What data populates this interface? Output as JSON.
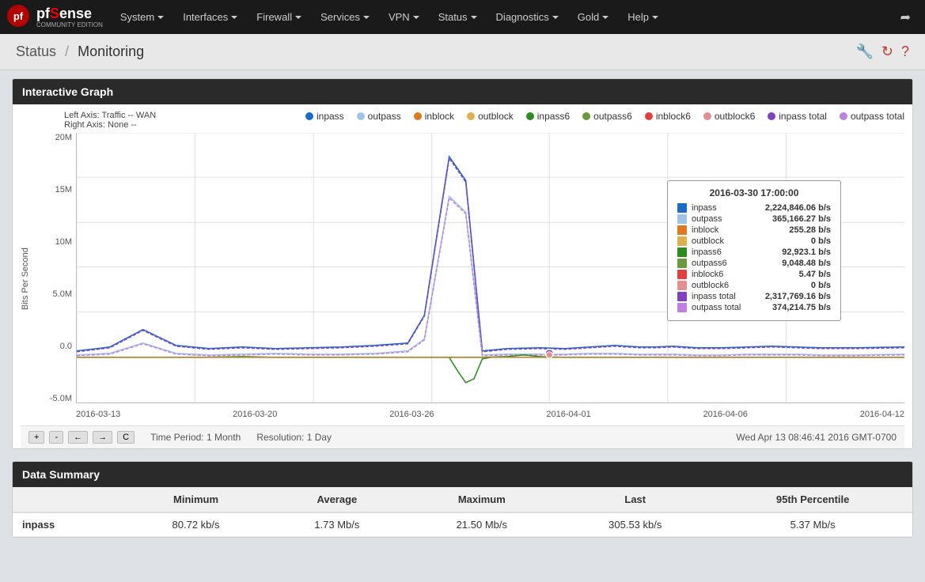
{
  "navbar": {
    "brand": "pfSense",
    "brand_highlight": "S",
    "brand_sub": "COMMUNITY EDITION",
    "items": [
      {
        "label": "System",
        "has_caret": true
      },
      {
        "label": "Interfaces",
        "has_caret": true
      },
      {
        "label": "Firewall",
        "has_caret": true
      },
      {
        "label": "Services",
        "has_caret": true
      },
      {
        "label": "VPN",
        "has_caret": true
      },
      {
        "label": "Status",
        "has_caret": true
      },
      {
        "label": "Diagnostics",
        "has_caret": true
      },
      {
        "label": "Gold",
        "has_caret": true
      },
      {
        "label": "Help",
        "has_caret": true
      }
    ]
  },
  "page": {
    "breadcrumb_parent": "Status",
    "breadcrumb_current": "Monitoring",
    "title": "Status / Monitoring"
  },
  "graph": {
    "section_title": "Interactive Graph",
    "axis_left": "Left Axis: Traffic -- WAN",
    "axis_right": "Right Axis: None --",
    "y_axis_label": "Bits Per Second",
    "y_ticks": [
      "20M",
      "15M",
      "10M",
      "5.0M",
      "0.0",
      "-5.0M"
    ],
    "x_labels": [
      "2016-03-13",
      "2016-03-20",
      "2016-03-26",
      "2016-04-01",
      "2016-04-06",
      "2016-04-12"
    ],
    "legend": [
      {
        "label": "inpass",
        "color": "#1a6cc4"
      },
      {
        "label": "outpass",
        "color": "#a0c4e8"
      },
      {
        "label": "inblock",
        "color": "#e07820"
      },
      {
        "label": "outblock",
        "color": "#e0b050"
      },
      {
        "label": "inpass6",
        "color": "#2e8b20"
      },
      {
        "label": "outpass6",
        "color": "#6a9a40"
      },
      {
        "label": "inblock6",
        "color": "#e04040"
      },
      {
        "label": "outblock6",
        "color": "#e09090"
      },
      {
        "label": "inpass total",
        "color": "#8040c0"
      },
      {
        "label": "outpass total",
        "color": "#c080e0"
      }
    ],
    "tooltip": {
      "timestamp": "2016-03-30 17:00:00",
      "rows": [
        {
          "label": "inpass",
          "value": "2,224,846.06 b/s",
          "color": "#1a6cc4"
        },
        {
          "label": "outpass",
          "value": "365,166.27 b/s",
          "color": "#a0c4e8"
        },
        {
          "label": "inblock",
          "value": "255.28 b/s",
          "color": "#e07820"
        },
        {
          "label": "outblock",
          "value": "0 b/s",
          "color": "#e0b050"
        },
        {
          "label": "inpass6",
          "value": "92,923.1 b/s",
          "color": "#2e8b20"
        },
        {
          "label": "outpass6",
          "value": "9,048.48 b/s",
          "color": "#6a9a40"
        },
        {
          "label": "inblock6",
          "value": "5.47 b/s",
          "color": "#e04040"
        },
        {
          "label": "outblock6",
          "value": "0 b/s",
          "color": "#e09090"
        },
        {
          "label": "inpass total",
          "value": "2,317,769.16 b/s",
          "color": "#8040c0"
        },
        {
          "label": "outpass total",
          "value": "374,214.75 b/s",
          "color": "#c080e0"
        }
      ]
    },
    "controls": {
      "time_period": "Time Period: 1 Month",
      "resolution": "Resolution: 1 Day",
      "timestamp": "Wed Apr 13 08:46:41 2016 GMT-0700"
    }
  },
  "summary": {
    "section_title": "Data Summary",
    "columns": [
      "",
      "Minimum",
      "Average",
      "Maximum",
      "Last",
      "95th Percentile"
    ],
    "rows": [
      {
        "label": "inpass",
        "min": "80.72 kb/s",
        "avg": "1.73 Mb/s",
        "max": "21.50 Mb/s",
        "last": "305.53 kb/s",
        "p95": "5.37 Mb/s"
      }
    ]
  }
}
